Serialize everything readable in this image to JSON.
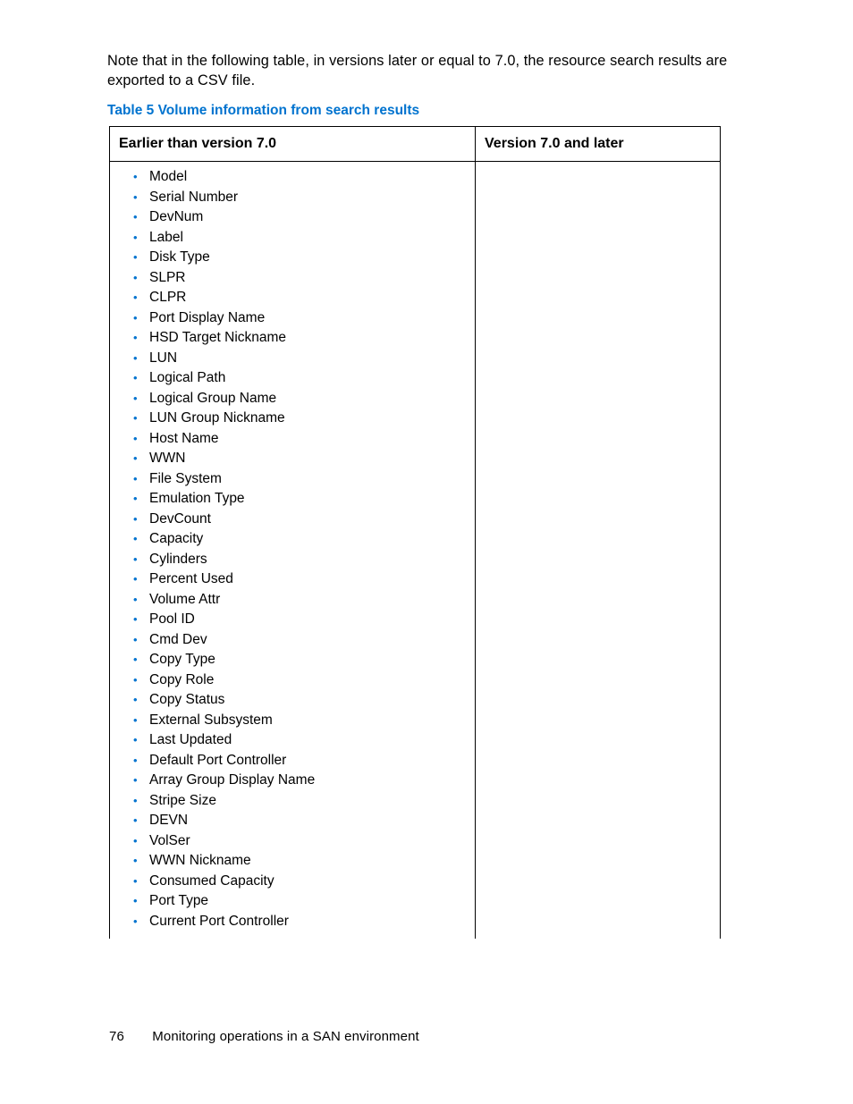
{
  "intro": "Note that in the following table, in versions later or equal to 7.0, the resource search results are exported to a CSV file.",
  "caption": "Table 5 Volume information from search results",
  "table": {
    "headers": [
      "Earlier than version 7.0",
      "Version 7.0 and later"
    ],
    "left_items": [
      "Model",
      "Serial Number",
      "DevNum",
      "Label",
      "Disk Type",
      "SLPR",
      "CLPR",
      "Port Display Name",
      "HSD Target Nickname",
      "LUN",
      "Logical Path",
      "Logical Group Name",
      "LUN Group Nickname",
      "Host Name",
      "WWN",
      "File System",
      "Emulation Type",
      "DevCount",
      "Capacity",
      "Cylinders",
      "Percent Used",
      "Volume Attr",
      "Pool ID",
      "Cmd Dev",
      "Copy Type",
      "Copy Role",
      "Copy Status",
      "External Subsystem",
      "Last Updated",
      "Default Port Controller",
      "Array Group Display Name",
      "Stripe Size",
      "DEVN",
      "VolSer",
      "WWN Nickname",
      "Consumed Capacity",
      "Port Type",
      "Current Port Controller"
    ]
  },
  "footer": {
    "page_number": "76",
    "section": "Monitoring operations in a SAN environment"
  }
}
